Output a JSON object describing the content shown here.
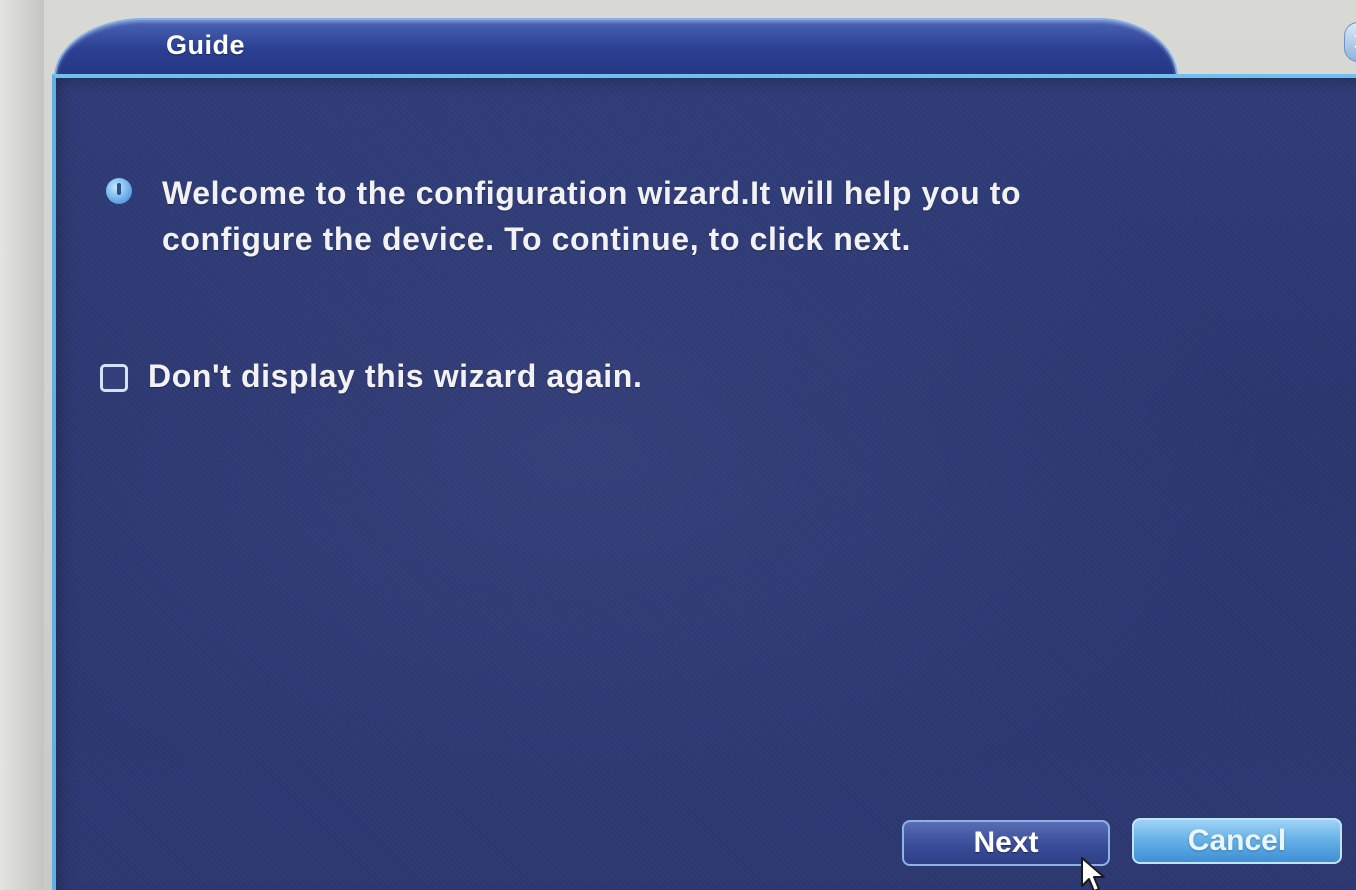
{
  "window": {
    "title": "Guide",
    "close_glyph": "✕"
  },
  "message": {
    "icon": "info-icon",
    "text": "Welcome to the configuration wizard.It will help you to configure the device. To continue, to click next."
  },
  "option": {
    "label": "Don't display this wizard again.",
    "checked": false
  },
  "buttons": {
    "next": "Next",
    "cancel": "Cancel"
  },
  "colors": {
    "panel_background": "#2d3872",
    "border_accent": "#6fc0ee",
    "cancel_button": "#63afe6",
    "text": "#f2f2f4"
  }
}
